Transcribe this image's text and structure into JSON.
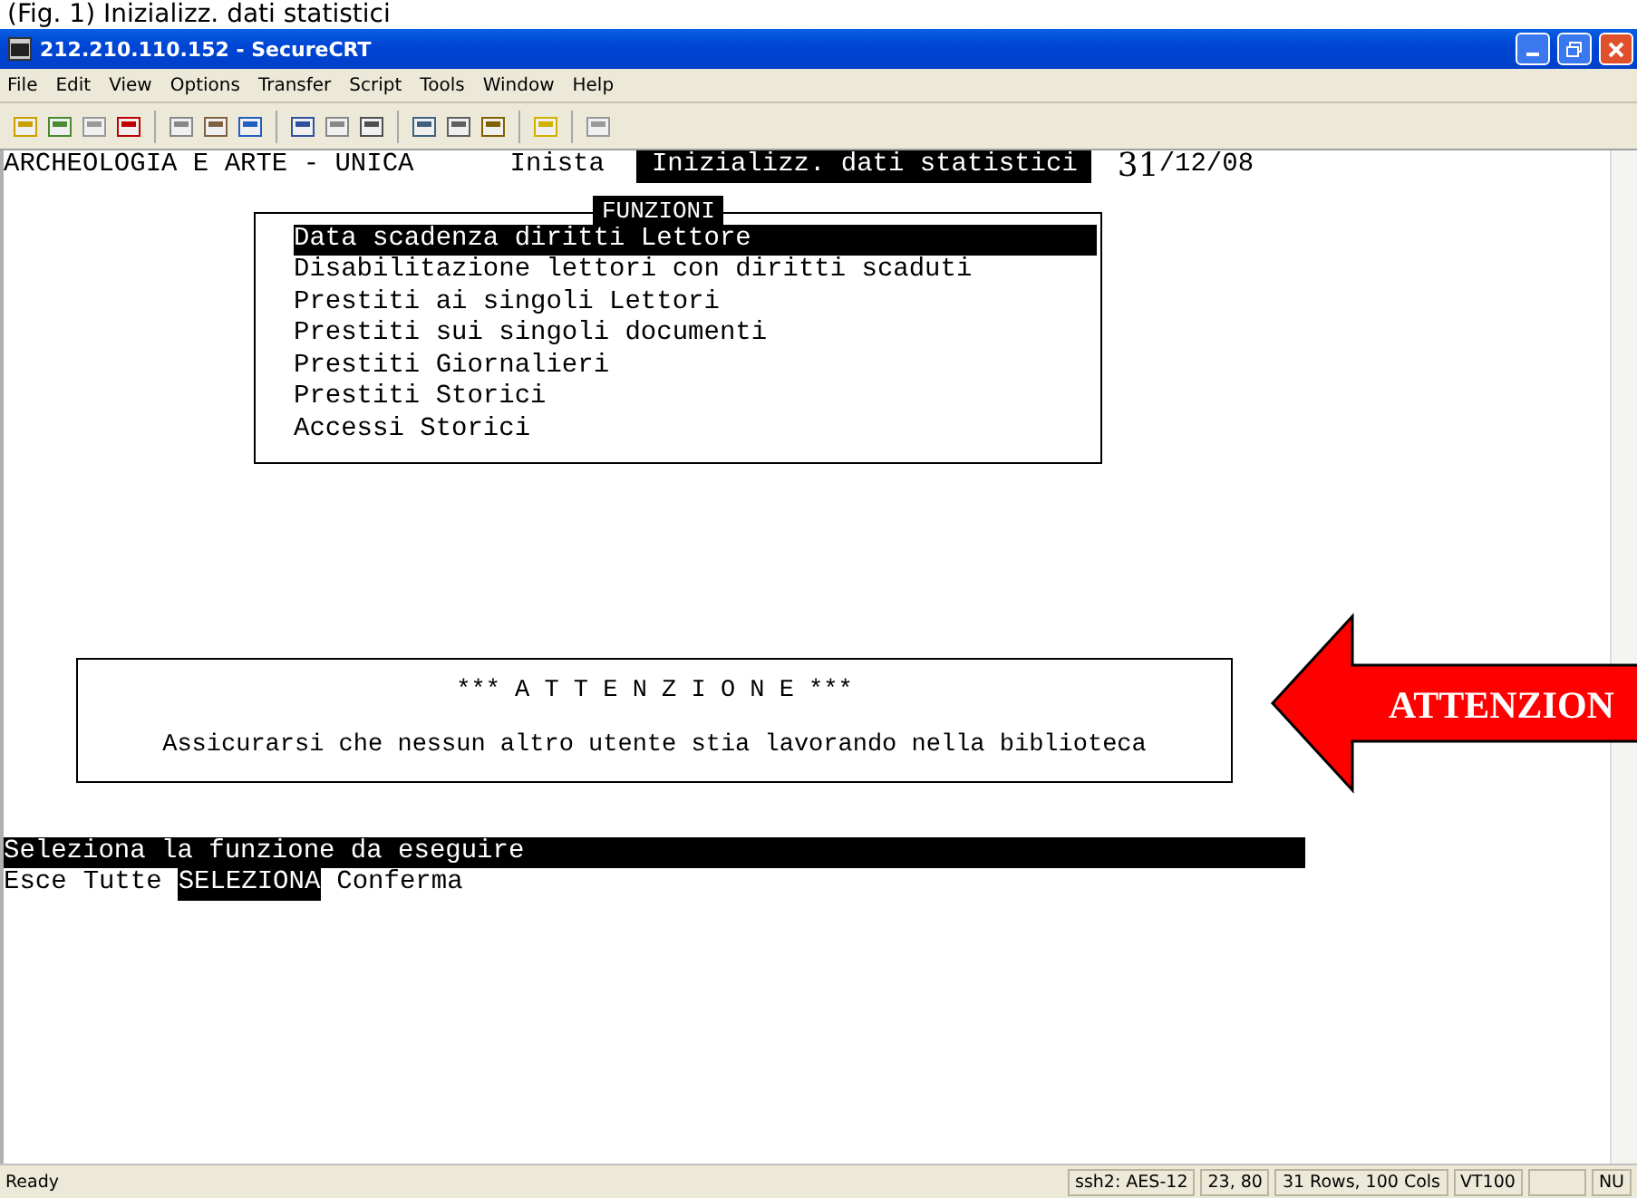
{
  "caption": "(Fig. 1) Inizializz. dati statistici",
  "window": {
    "title": "212.210.110.152 - SecureCRT"
  },
  "menu": [
    "File",
    "Edit",
    "View",
    "Options",
    "Transfer",
    "Script",
    "Tools",
    "Window",
    "Help"
  ],
  "terminal": {
    "header": {
      "app": "ARCHEOLOGIA E ARTE - UNICA",
      "user": "Inista",
      "function": "Inizializz. dati statistici",
      "date_handwritten": "31",
      "date_rest": "/12/08"
    },
    "menu_box": {
      "title": "FUNZIONI",
      "items": [
        {
          "label": "Data scadenza diritti Lettore",
          "selected": true
        },
        {
          "label": "Disabilitazione lettori con diritti scaduti",
          "selected": false
        },
        {
          "label": "Prestiti ai singoli Lettori",
          "selected": false
        },
        {
          "label": "Prestiti sui singoli documenti",
          "selected": false
        },
        {
          "label": "Prestiti Giornalieri",
          "selected": false
        },
        {
          "label": "Prestiti Storici",
          "selected": false
        },
        {
          "label": "Accessi Storici",
          "selected": false
        }
      ]
    },
    "notice": {
      "title": "*** A T T E N Z I O N E ***",
      "message": "Assicurarsi che nessun altro utente stia lavorando nella biblioteca"
    },
    "prompt": "Seleziona la funzione da eseguire",
    "keys": [
      {
        "label": "Esce",
        "selected": false
      },
      {
        "label": "Tutte",
        "selected": false
      },
      {
        "label": "SELEZIONA",
        "selected": true
      },
      {
        "label": "Conferma",
        "selected": false
      }
    ]
  },
  "arrow_callout": {
    "label": "ATTENZION"
  },
  "status_bar": {
    "message": "Ready",
    "panes": [
      "ssh2: AES-12",
      "23,  80",
      "31 Rows, 100 Cols",
      "VT100",
      "NU"
    ]
  }
}
